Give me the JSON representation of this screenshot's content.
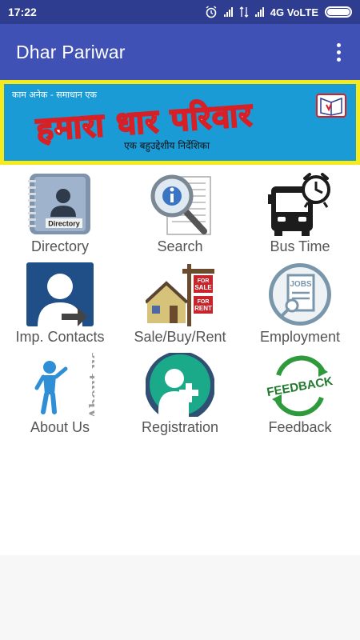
{
  "status_bar": {
    "time": "17:22",
    "network": "4G VoLTE"
  },
  "app_bar": {
    "title": "Dhar Pariwar",
    "menu_icon": "overflow-menu-icon"
  },
  "banner": {
    "tagline": "काम अनेक - समाधान एक",
    "title": "हमारा धार परिवार",
    "subtitle": "एक बहुउद्देशीय निर्देशिका",
    "colors": {
      "border": "#f4ea1c",
      "background": "#1a9bd6",
      "title_outline": "#d71f26"
    }
  },
  "menu": {
    "items": [
      {
        "label": "Directory",
        "icon": "directory-book-icon",
        "icon_text": "Directory"
      },
      {
        "label": "Search",
        "icon": "magnifier-document-icon"
      },
      {
        "label": "Bus Time",
        "icon": "bus-clock-icon"
      },
      {
        "label": "Imp. Contacts",
        "icon": "contact-person-icon"
      },
      {
        "label": "Sale/Buy/Rent",
        "icon": "house-sale-sign-icon",
        "icon_text": [
          "FOR",
          "SALE",
          "FOR",
          "RENT"
        ]
      },
      {
        "label": "Employment",
        "icon": "jobs-search-icon",
        "icon_text": "JOBS"
      },
      {
        "label": "About Us",
        "icon": "about-us-figure-icon",
        "icon_text": "About us"
      },
      {
        "label": "Registration",
        "icon": "add-user-icon"
      },
      {
        "label": "Feedback",
        "icon": "feedback-arrows-icon",
        "icon_text": "FEEDBACK"
      }
    ]
  },
  "colors": {
    "status_bar": "#2e3d8f",
    "app_bar": "#3f51b5",
    "label_text": "#555555"
  }
}
